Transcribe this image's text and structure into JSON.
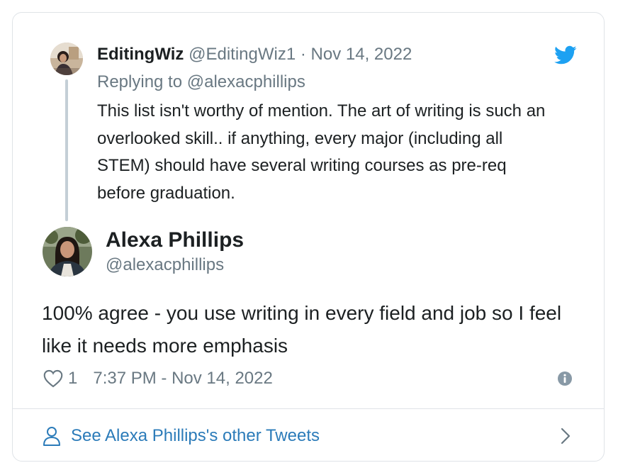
{
  "parent_tweet": {
    "name": "EditingWiz",
    "handle": "@EditingWiz1",
    "separator": "·",
    "date": "Nov 14, 2022",
    "reply_to": "Replying to @alexacphillips",
    "text": "This list isn't worthy of mention. The art of writing is such an overlooked skill.. if anything, every major (including all STEM) should have several writing courses as pre-req before graduation."
  },
  "main_tweet": {
    "name": "Alexa Phillips",
    "handle": "@alexacphillips",
    "text": "100% agree - you use writing in every field and job so I feel like it needs more emphasis",
    "likes": "1",
    "timestamp": "7:37 PM - Nov 14, 2022"
  },
  "footer": {
    "link_label": "See Alexa Phillips's other Tweets"
  },
  "colors": {
    "accent": "#2b7bb9",
    "twitter_blue": "#1da1f2",
    "muted_text": "#697882",
    "border": "#dfe3e7"
  },
  "icons": {
    "brand": "twitter-bird-icon",
    "like": "heart-icon",
    "info": "info-icon",
    "profile": "person-icon",
    "next": "chevron-right-icon"
  }
}
